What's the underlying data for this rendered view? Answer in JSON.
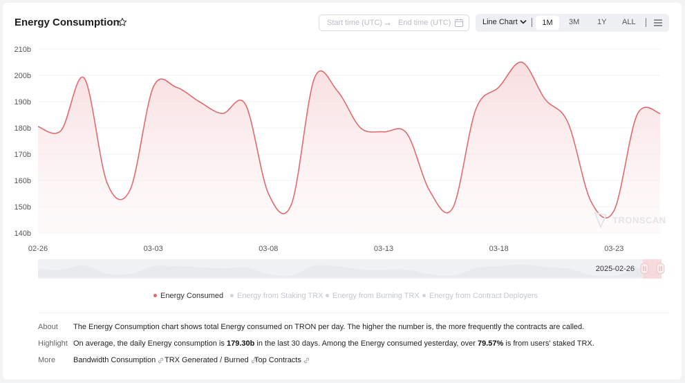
{
  "header": {
    "title": "Energy Consumption",
    "start_placeholder": "Start time (UTC)",
    "arrow": "→",
    "end_placeholder": "End time (UTC)"
  },
  "toolbar": {
    "chart_type": "Line Chart",
    "ranges": [
      "1M",
      "3M",
      "1Y",
      "ALL"
    ],
    "selected_range": "1M"
  },
  "watermark": "TRONSCAN",
  "slider": {
    "end_label": "2025-02-26"
  },
  "icons": [
    "star-icon",
    "calendar-icon",
    "arrow-right-icon",
    "chevron-down-icon",
    "menu-icon",
    "link-icon",
    "tronscan-logo-icon"
  ],
  "colors": {
    "series": "#e06a6e",
    "accent_range": "#f3c6c9",
    "inactive_legend": "#c3c7cf"
  },
  "chart_data": {
    "type": "area",
    "x": [
      "02-26",
      "02-27",
      "02-28",
      "03-01",
      "03-02",
      "03-03",
      "03-04",
      "03-05",
      "03-06",
      "03-07",
      "03-08",
      "03-09",
      "03-10",
      "03-11",
      "03-12",
      "03-13",
      "03-14",
      "03-15",
      "03-16",
      "03-17",
      "03-18",
      "03-19",
      "03-20",
      "03-21",
      "03-22",
      "03-23",
      "03-24",
      "03-25"
    ],
    "x_ticks": [
      "02-26",
      "03-03",
      "03-08",
      "03-13",
      "03-18",
      "03-23"
    ],
    "y_ticks": [
      "140b",
      "150b",
      "160b",
      "170b",
      "180b",
      "190b",
      "200b",
      "210b"
    ],
    "ylim": [
      140,
      210
    ],
    "y_unit": "b",
    "series": [
      {
        "name": "Energy Consumed",
        "values": [
          180.5,
          179,
          199,
          159,
          156.5,
          195.5,
          195.5,
          190,
          185.5,
          189,
          155,
          151,
          199,
          194,
          180,
          178.5,
          178,
          156,
          149.5,
          187,
          195.5,
          205,
          191,
          182,
          152,
          148.5,
          185,
          185.5
        ],
        "active": true
      },
      {
        "name": "Energy from Staking TRX",
        "active": false
      },
      {
        "name": "Energy from Burning TRX",
        "active": false
      },
      {
        "name": "Energy from Contract Deployers",
        "active": false
      }
    ],
    "grid": true,
    "legend_position": "bottom"
  },
  "info": {
    "about_label": "About",
    "about_text": "The Energy Consumption chart shows total Energy consumed on TRON per day. The higher the number is, the more frequently the contracts are called.",
    "highlight_label": "Highlight",
    "highlight_pre": "On average, the daily Energy consumption is ",
    "highlight_value1": "179.30b",
    "highlight_mid": " in the last 30 days.  Among the Energy consumed yesterday, over ",
    "highlight_value2": "79.57%",
    "highlight_post": " is from users' staked TRX.",
    "more_label": "More",
    "more_links": [
      "Bandwidth Consumption",
      "TRX Generated / Burned",
      "Top Contracts"
    ]
  }
}
